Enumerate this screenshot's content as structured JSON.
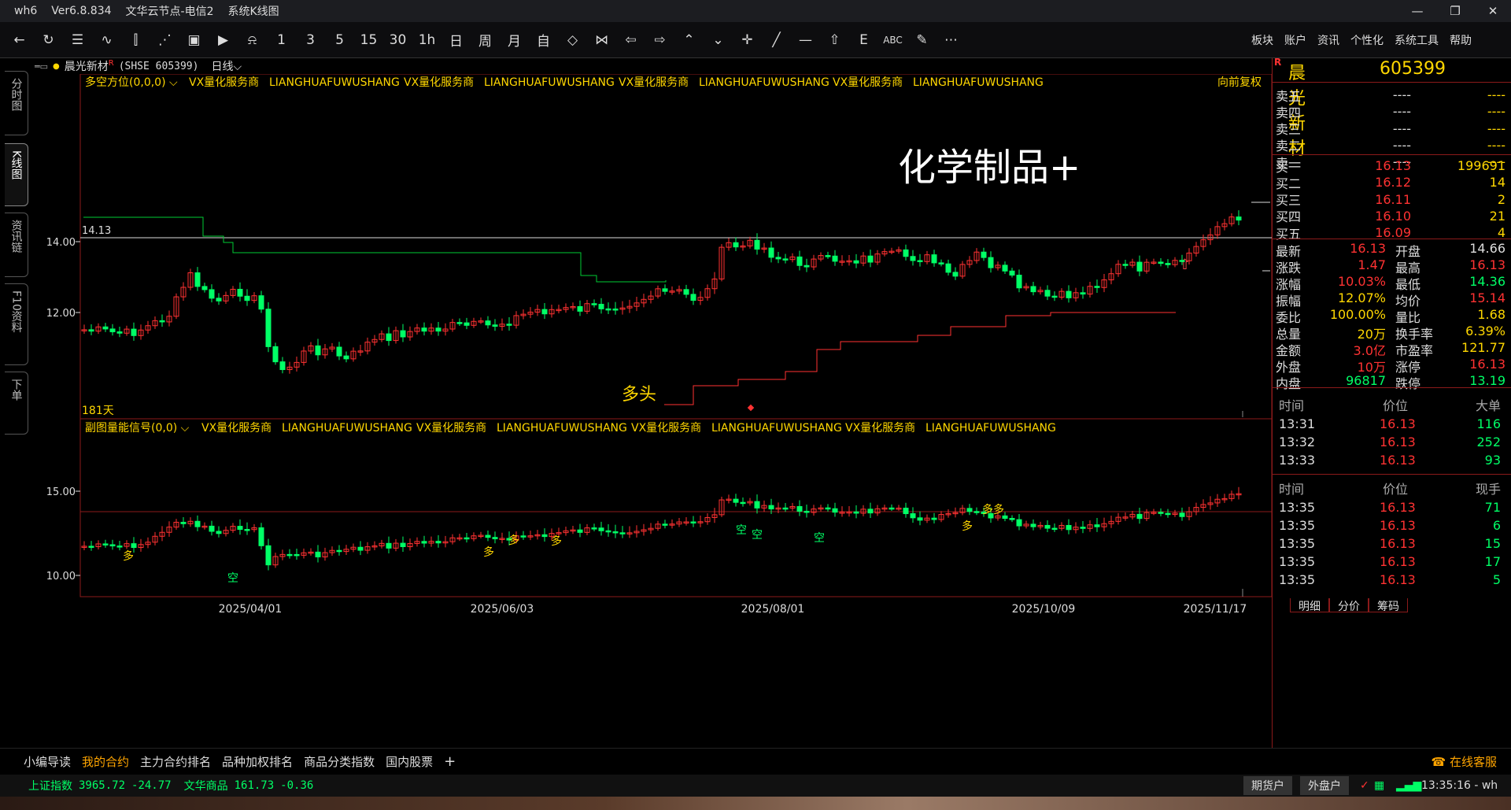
{
  "window": {
    "app": "wh6",
    "version": "Ver6.8.834",
    "node": "文华云节点-电信2",
    "view": "系统K线图"
  },
  "toolbar": {
    "buttons": [
      "back-icon",
      "refresh-icon",
      "list-icon",
      "trend-icon",
      "kline-icon",
      "multi-period-icon",
      "board-icon",
      "play-circle-icon",
      "bell-icon",
      "1",
      "3",
      "5",
      "15",
      "30",
      "1h",
      "日",
      "周",
      "月",
      "自",
      "shrink-icon",
      "expand-icon",
      "prev-icon",
      "next-icon",
      "up-icon",
      "down-icon",
      "cursor-icon",
      "line-tool-icon",
      "hline-icon",
      "arrow-up-icon",
      "E",
      "ABC",
      "pen-icon",
      "more-icon"
    ],
    "menus": [
      "板块",
      "账户",
      "资讯",
      "个性化",
      "系统工具",
      "帮助"
    ]
  },
  "leftrail": {
    "tabs": [
      "分时图",
      "K线图",
      "资讯链",
      "F10资料",
      "下单"
    ]
  },
  "chart_info": {
    "name": "晨光新材",
    "mark": "R",
    "code": "(SHSE 605399)",
    "period": "日线"
  },
  "main_panel": {
    "indicator": "多空方位(0,0,0)",
    "ads": [
      "VX量化服务商",
      "LIANGHUAFUWUSHANG",
      "VX量化服务商",
      "LIANGHUAFUWUSHANG",
      "VX量化服务商",
      "LIANGHUAFUWUSHANG",
      "VX量化服务商",
      "LIANGHUAFUWUSHANG"
    ],
    "adjust": "向前复权",
    "price_level": "14.13",
    "annotation": "化学制品+",
    "signal_label": "多头",
    "days": "181天",
    "y_ticks": [
      "14.00",
      "12.00"
    ]
  },
  "sub_panel": {
    "indicator": "副图量能信号(0,0)",
    "ads": [
      "VX量化服务商",
      "LIANGHUAFUWUSHANG",
      "VX量化服务商",
      "LIANGHUAFUWUSHANG",
      "VX量化服务商",
      "LIANGHUAFUWUSHANG",
      "VX量化服务商",
      "LIANGHUAFUWUSHANG"
    ],
    "y_ticks": [
      "15.00",
      "10.00"
    ],
    "signals_duo": "多",
    "signals_kong": "空"
  },
  "x_axis": {
    "dates": [
      "2025/04/01",
      "2025/06/03",
      "2025/08/01",
      "2025/10/09",
      "2025/11/17"
    ]
  },
  "quote": {
    "mark": "R",
    "name": "晨光新材",
    "code": "605399",
    "asks": [
      {
        "label": "卖五",
        "price": "----",
        "vol": "----"
      },
      {
        "label": "卖四",
        "price": "----",
        "vol": "----"
      },
      {
        "label": "卖三",
        "price": "----",
        "vol": "----"
      },
      {
        "label": "卖二",
        "price": "----",
        "vol": "----"
      },
      {
        "label": "卖一",
        "price": "----",
        "vol": "----"
      }
    ],
    "bids": [
      {
        "label": "买一",
        "price": "16.13",
        "vol": "199691"
      },
      {
        "label": "买二",
        "price": "16.12",
        "vol": "14"
      },
      {
        "label": "买三",
        "price": "16.11",
        "vol": "2"
      },
      {
        "label": "买四",
        "price": "16.10",
        "vol": "21"
      },
      {
        "label": "买五",
        "price": "16.09",
        "vol": "4"
      }
    ],
    "stats": [
      {
        "l1": "最新",
        "v1": "16.13",
        "c1": "red",
        "l2": "开盘",
        "v2": "14.66",
        "c2": "wht"
      },
      {
        "l1": "涨跌",
        "v1": "1.47",
        "c1": "red",
        "l2": "最高",
        "v2": "16.13",
        "c2": "red"
      },
      {
        "l1": "涨幅",
        "v1": "10.03%",
        "c1": "red",
        "l2": "最低",
        "v2": "14.36",
        "c2": "grn"
      },
      {
        "l1": "振幅",
        "v1": "12.07%",
        "c1": "yel",
        "l2": "均价",
        "v2": "15.14",
        "c2": "red"
      },
      {
        "l1": "委比",
        "v1": "100.00%",
        "c1": "yel",
        "l2": "量比",
        "v2": "1.68",
        "c2": "yel"
      },
      {
        "l1": "总量",
        "v1": "20万",
        "c1": "yel",
        "l2": "换手率",
        "v2": "6.39%",
        "c2": "yel"
      },
      {
        "l1": "金额",
        "v1": "3.0亿",
        "c1": "red",
        "l2": "市盈率",
        "v2": "121.77",
        "c2": "yel"
      },
      {
        "l1": "外盘",
        "v1": "10万",
        "c1": "red",
        "l2": "涨停",
        "v2": "16.13",
        "c2": "red"
      },
      {
        "l1": "内盘",
        "v1": "96817",
        "c1": "grn",
        "l2": "跌停",
        "v2": "13.19",
        "c2": "grn"
      }
    ],
    "trades_head": {
      "time": "时间",
      "price": "价位",
      "big": "大单"
    },
    "big_trades": [
      {
        "time": "13:31",
        "price": "16.13",
        "vol": "116"
      },
      {
        "time": "13:32",
        "price": "16.13",
        "vol": "252"
      },
      {
        "time": "13:33",
        "price": "16.13",
        "vol": "93"
      }
    ],
    "ticks_head": {
      "time": "时间",
      "price": "价位",
      "hand": "现手"
    },
    "ticks": [
      {
        "time": "13:35",
        "price": "16.13",
        "vol": "71"
      },
      {
        "time": "13:35",
        "price": "16.13",
        "vol": "6"
      },
      {
        "time": "13:35",
        "price": "16.13",
        "vol": "15"
      },
      {
        "time": "13:35",
        "price": "16.13",
        "vol": "17"
      },
      {
        "time": "13:35",
        "price": "16.13",
        "vol": "5"
      }
    ],
    "bottom_tabs": [
      "明细",
      "分价",
      "筹码"
    ]
  },
  "bottom_tabs": [
    "小编导读",
    "我的合约",
    "主力合约排名",
    "品种加权排名",
    "商品分类指数",
    "国内股票"
  ],
  "customer_service": "在线客服",
  "status": {
    "index1_name": "上证指数",
    "index1_value": "3965.72",
    "index1_change": "-24.77",
    "index2_name": "文华商品",
    "index2_value": "161.73",
    "index2_change": "-0.36",
    "btn_futures": "期货户",
    "btn_forex": "外盘户",
    "clock": "13:35:16 - wh"
  },
  "colors": {
    "up": "#ff3232",
    "down": "#00ff66",
    "accent": "#ffd700",
    "frame": "#8b1a1a"
  }
}
